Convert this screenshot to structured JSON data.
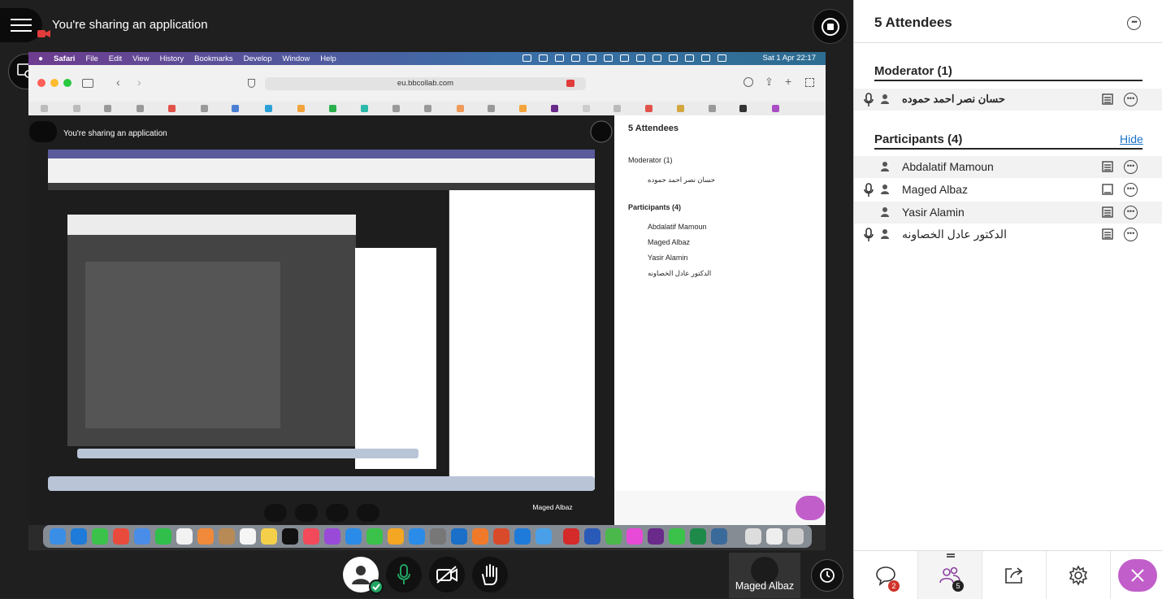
{
  "share": {
    "status_text": "You're sharing an application"
  },
  "mac": {
    "menu": [
      "Safari",
      "File",
      "Edit",
      "View",
      "History",
      "Bookmarks",
      "Develop",
      "Window",
      "Help"
    ],
    "clock": "Sat 1 Apr  22:17",
    "url": "eu.bbcollab.com"
  },
  "panel": {
    "title": "5 Attendees",
    "more_icon": "more-icon",
    "moderator_header": "Moderator (1)",
    "participants_header": "Participants (4)",
    "hide_label": "Hide",
    "moderators": [
      {
        "name": "حسان نصر احمد حموده",
        "mic": true
      }
    ],
    "participants": [
      {
        "name": "Abdalatif Mamoun",
        "mic": false
      },
      {
        "name": "Maged Albaz",
        "mic": true
      },
      {
        "name": "Yasir Alamin",
        "mic": false
      },
      {
        "name": "الدكتور عادل الخصاونه",
        "mic": true
      }
    ],
    "tabs": [
      {
        "icon": "chat-icon",
        "badge": "2"
      },
      {
        "icon": "attendees-icon",
        "badge": "5"
      },
      {
        "icon": "share-content-icon"
      },
      {
        "icon": "settings-icon"
      }
    ]
  },
  "video": {
    "name": "Maged Albaz"
  },
  "colors": {
    "accent": "#c15ec9",
    "link": "#1a73c8",
    "online": "#21a361",
    "chat_badge": "#d0342c"
  }
}
